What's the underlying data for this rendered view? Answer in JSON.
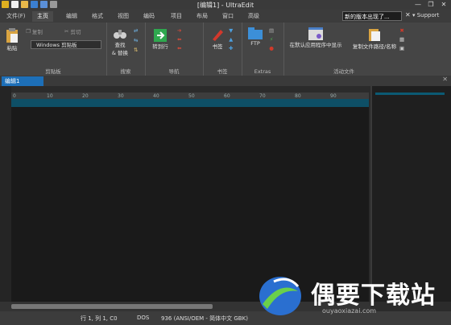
{
  "window": {
    "title": "[编辑1] - UltraEdit",
    "min": "—",
    "restore": "❐",
    "close": "✕"
  },
  "menu_tabs": [
    "文件(F)",
    "主页",
    "编辑",
    "格式",
    "视图",
    "编码",
    "项目",
    "布局",
    "窗口",
    "高级"
  ],
  "notice": "新的版本出现了...",
  "support": "▾ Support",
  "ribbon": {
    "clipboard": {
      "paste": "粘贴",
      "copy": "复制",
      "cut": "剪切",
      "combo": "Windows 剪贴板",
      "label": "剪贴板"
    },
    "search": {
      "find": "查找",
      "replace": "& 替换",
      "label": "搜索"
    },
    "nav": {
      "goto": "转到行",
      "label": "导航"
    },
    "bookmarks": {
      "bookmark": "书签",
      "label": "书签"
    },
    "extras": {
      "ftp": "FTP",
      "label": "Extras"
    },
    "active": {
      "open_default": "在默认应用程序中显示",
      "copy_path": "复制文件路径/名称",
      "label": "活动文件"
    }
  },
  "doc_tab": "编辑1",
  "ruler_numbers": [
    "0",
    "10",
    "20",
    "30",
    "40",
    "50",
    "60",
    "70",
    "80",
    "90"
  ],
  "status": {
    "pos": "行 1, 列 1, C0",
    "eol": "DOS",
    "encoding": "936  (ANSI/OEM - 简体中文 GBK)"
  },
  "watermark": {
    "text": "偶要下载站",
    "url": "ouyaoxiazai.com"
  },
  "colors": {
    "accent": "#1d6fb8",
    "ruler_band": "#0b5a73",
    "editor_bg": "#1a1a1a"
  }
}
